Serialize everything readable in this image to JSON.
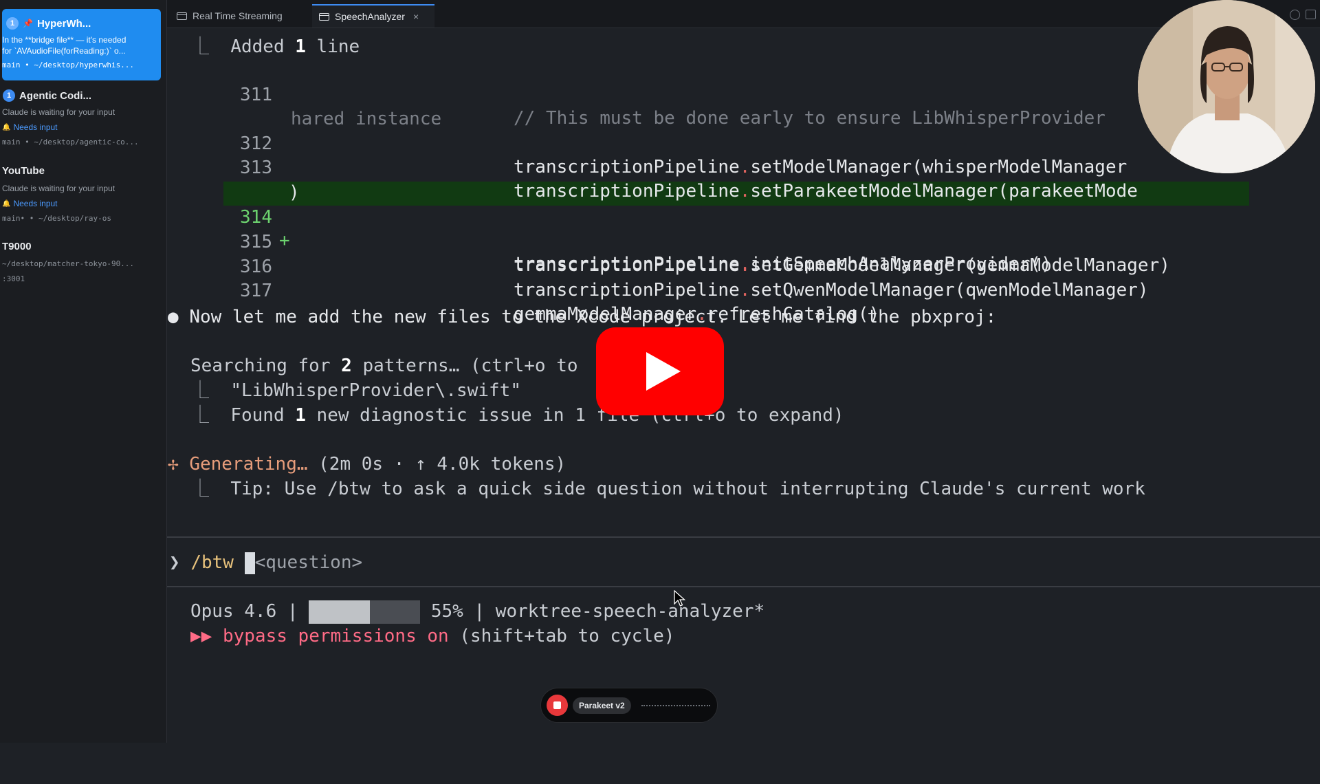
{
  "sidebar": {
    "sessions": [
      {
        "badge": "1",
        "title": "HyperWh...",
        "detail_1": "In the **bridge file** — it's needed",
        "detail_2": "for `AVAudioFile(forReading:)` o...",
        "path": "main • ~/desktop/hyperwhis..."
      },
      {
        "badge": "1",
        "title": "Agentic Codi...",
        "status": "Claude is waiting for your input",
        "needs": "Needs input",
        "path": "main • ~/desktop/agentic-co..."
      },
      {
        "title": "YouTube",
        "status": "Claude is waiting for your input",
        "needs": "Needs input",
        "path": "main• • ~/desktop/ray-os"
      },
      {
        "title": "T9000",
        "path": "~/desktop/matcher-tokyo-90...",
        "port": ":3001"
      }
    ]
  },
  "tabs": [
    {
      "label": "Real Time Streaming",
      "active": false
    },
    {
      "label": "SpeechAnalyzer",
      "active": true,
      "close": "×"
    }
  ],
  "terminal": {
    "added_marker": "⎿",
    "added_pre": "Added ",
    "added_num": "1",
    "added_post": " line",
    "lines": [
      {
        "num": "311",
        "comment": "// This must be done early to ensure LibWhisperProvider"
      },
      {
        "cont": "hared instance"
      },
      {
        "num": "312",
        "obj": "transcriptionPipeline",
        "dot": ".",
        "call": "setModelManager(whisperModelManager"
      },
      {
        "num": "313",
        "obj": "transcriptionPipeline",
        "dot": ".",
        "call": "setParakeetModelManager(parakeetMode"
      },
      {
        "paren": ")"
      },
      {
        "num": "314",
        "plus": "+",
        "obj": "transcriptionPipeline",
        "dot": ".",
        "call": "initSpeechAnalyzerProvider()"
      },
      {
        "num": "315",
        "obj": "transcriptionPipeline",
        "dot": ".",
        "call": "setGemmaModelManager(gemmaModelManager)"
      },
      {
        "num": "316",
        "obj": "transcriptionPipeline",
        "dot": ".",
        "call": "setQwenModelManager(qwenModelManager)"
      },
      {
        "num": "317",
        "obj": "gemmaModelManager",
        "dot": ".",
        "call": "refreshCatalog()"
      }
    ],
    "bullet": "●",
    "message": "Now let me add the new files to the Xcode project. Let me find the pbxproj:",
    "search_pre": "Searching for ",
    "search_num": "2",
    "search_post": " patterns… (ctrl+o to",
    "search_result": "\"LibWhisperProvider\\.swift\"",
    "found_pre": "Found ",
    "found_num": "1",
    "found_post": " new diagnostic issue in 1 file (ctrl+o to expand)",
    "gen_icon": "✢",
    "generating": "Generating…",
    "gen_stats": " (2m 0s · ↑ 4.0k tokens)",
    "tip": "Tip: Use /btw to ask a quick side question without interrupting Claude's current work"
  },
  "prompt": {
    "chevron": "❯",
    "command": "/btw",
    "placeholder": "<question>"
  },
  "status": {
    "model": "Opus 4.6",
    "sep": "|",
    "context_percent": 55,
    "context_label": "55%",
    "branch": "worktree-speech-analyzer*",
    "arrows": "▶▶",
    "bypass": "bypass permissions on",
    "cycle_hint": " (shift+tab to cycle)"
  },
  "recorder": {
    "model": "Parakeet v2"
  },
  "colors": {
    "accent": "#1f8cf0",
    "added_bg": "#113a12",
    "youtube_red": "#ff0000",
    "generating": "#e79d7b",
    "bypass": "#ff6b86"
  }
}
